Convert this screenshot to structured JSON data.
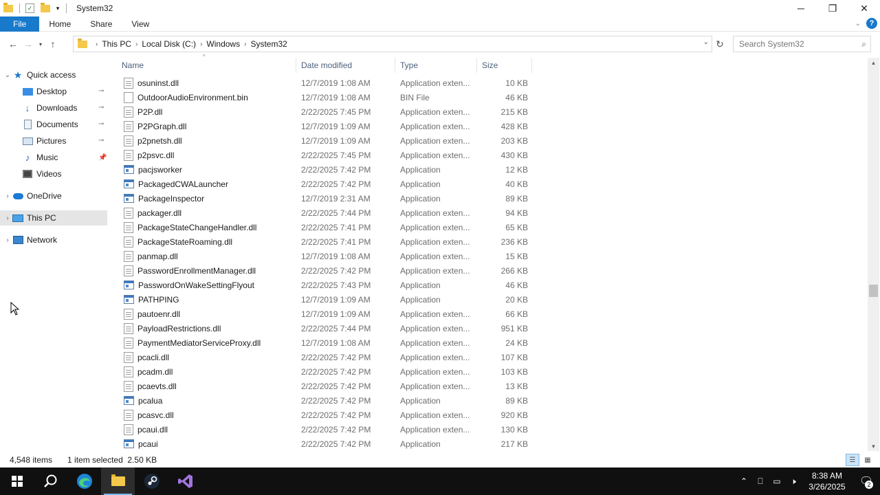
{
  "window": {
    "title": "System32",
    "minimize_glyph": "─",
    "restore_glyph": "❐",
    "close_glyph": "✕"
  },
  "ribbon": {
    "tabs": [
      "File",
      "Home",
      "Share",
      "View"
    ]
  },
  "address": {
    "crumbs": [
      "This PC",
      "Local Disk (C:)",
      "Windows",
      "System32"
    ]
  },
  "search": {
    "placeholder": "Search System32"
  },
  "navpane": {
    "quick_access": "Quick access",
    "items": [
      {
        "label": "Desktop",
        "icon": "desktop-icon",
        "pinned": true
      },
      {
        "label": "Downloads",
        "icon": "downloads-icon",
        "pinned": true
      },
      {
        "label": "Documents",
        "icon": "documents-icon",
        "pinned": true
      },
      {
        "label": "Pictures",
        "icon": "pictures-icon",
        "pinned": true
      },
      {
        "label": "Music",
        "icon": "music-icon",
        "pinned": false
      },
      {
        "label": "Videos",
        "icon": "videos-icon",
        "pinned": false
      }
    ],
    "onedrive": "OneDrive",
    "this_pc": "This PC",
    "network": "Network"
  },
  "columns": {
    "name": "Name",
    "date": "Date modified",
    "type": "Type",
    "size": "Size"
  },
  "files": [
    {
      "name": "osuninst.dll",
      "date": "12/7/2019 1:08 AM",
      "type": "Application exten...",
      "size": "10 KB",
      "kind": "dll"
    },
    {
      "name": "OutdoorAudioEnvironment.bin",
      "date": "12/7/2019 1:08 AM",
      "type": "BIN File",
      "size": "46 KB",
      "kind": "file"
    },
    {
      "name": "P2P.dll",
      "date": "2/22/2025 7:45 PM",
      "type": "Application exten...",
      "size": "215 KB",
      "kind": "dll"
    },
    {
      "name": "P2PGraph.dll",
      "date": "12/7/2019 1:09 AM",
      "type": "Application exten...",
      "size": "428 KB",
      "kind": "dll"
    },
    {
      "name": "p2pnetsh.dll",
      "date": "12/7/2019 1:09 AM",
      "type": "Application exten...",
      "size": "203 KB",
      "kind": "dll"
    },
    {
      "name": "p2psvc.dll",
      "date": "2/22/2025 7:45 PM",
      "type": "Application exten...",
      "size": "430 KB",
      "kind": "dll"
    },
    {
      "name": "pacjsworker",
      "date": "2/22/2025 7:42 PM",
      "type": "Application",
      "size": "12 KB",
      "kind": "app"
    },
    {
      "name": "PackagedCWALauncher",
      "date": "2/22/2025 7:42 PM",
      "type": "Application",
      "size": "40 KB",
      "kind": "app"
    },
    {
      "name": "PackageInspector",
      "date": "12/7/2019 2:31 AM",
      "type": "Application",
      "size": "89 KB",
      "kind": "app"
    },
    {
      "name": "packager.dll",
      "date": "2/22/2025 7:44 PM",
      "type": "Application exten...",
      "size": "94 KB",
      "kind": "dll"
    },
    {
      "name": "PackageStateChangeHandler.dll",
      "date": "2/22/2025 7:41 PM",
      "type": "Application exten...",
      "size": "65 KB",
      "kind": "dll"
    },
    {
      "name": "PackageStateRoaming.dll",
      "date": "2/22/2025 7:41 PM",
      "type": "Application exten...",
      "size": "236 KB",
      "kind": "dll"
    },
    {
      "name": "panmap.dll",
      "date": "12/7/2019 1:08 AM",
      "type": "Application exten...",
      "size": "15 KB",
      "kind": "dll"
    },
    {
      "name": "PasswordEnrollmentManager.dll",
      "date": "2/22/2025 7:42 PM",
      "type": "Application exten...",
      "size": "266 KB",
      "kind": "dll"
    },
    {
      "name": "PasswordOnWakeSettingFlyout",
      "date": "2/22/2025 7:43 PM",
      "type": "Application",
      "size": "46 KB",
      "kind": "app"
    },
    {
      "name": "PATHPING",
      "date": "12/7/2019 1:09 AM",
      "type": "Application",
      "size": "20 KB",
      "kind": "app"
    },
    {
      "name": "pautoenr.dll",
      "date": "12/7/2019 1:09 AM",
      "type": "Application exten...",
      "size": "66 KB",
      "kind": "dll"
    },
    {
      "name": "PayloadRestrictions.dll",
      "date": "2/22/2025 7:44 PM",
      "type": "Application exten...",
      "size": "951 KB",
      "kind": "dll"
    },
    {
      "name": "PaymentMediatorServiceProxy.dll",
      "date": "12/7/2019 1:08 AM",
      "type": "Application exten...",
      "size": "24 KB",
      "kind": "dll"
    },
    {
      "name": "pcacli.dll",
      "date": "2/22/2025 7:42 PM",
      "type": "Application exten...",
      "size": "107 KB",
      "kind": "dll"
    },
    {
      "name": "pcadm.dll",
      "date": "2/22/2025 7:42 PM",
      "type": "Application exten...",
      "size": "103 KB",
      "kind": "dll"
    },
    {
      "name": "pcaevts.dll",
      "date": "2/22/2025 7:42 PM",
      "type": "Application exten...",
      "size": "13 KB",
      "kind": "dll"
    },
    {
      "name": "pcalua",
      "date": "2/22/2025 7:42 PM",
      "type": "Application",
      "size": "89 KB",
      "kind": "app"
    },
    {
      "name": "pcasvc.dll",
      "date": "2/22/2025 7:42 PM",
      "type": "Application exten...",
      "size": "920 KB",
      "kind": "dll"
    },
    {
      "name": "pcaui.dll",
      "date": "2/22/2025 7:42 PM",
      "type": "Application exten...",
      "size": "130 KB",
      "kind": "dll"
    },
    {
      "name": "pcaui",
      "date": "2/22/2025 7:42 PM",
      "type": "Application",
      "size": "217 KB",
      "kind": "app"
    }
  ],
  "status": {
    "item_count": "4,548 items",
    "selection": "1 item selected  2.50 KB"
  },
  "taskbar": {
    "time": "8:38 AM",
    "date": "3/26/2025",
    "notification_count": "2"
  },
  "colors": {
    "accent": "#1979ca",
    "selection": "#e5e5e5",
    "taskbar": "#101010"
  }
}
